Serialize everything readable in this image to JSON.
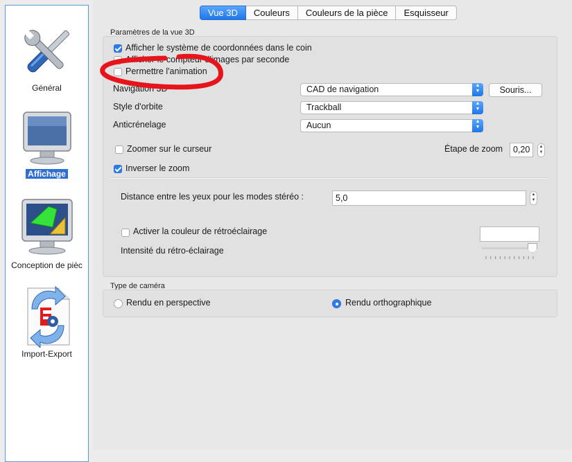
{
  "sidebar": {
    "items": [
      {
        "label": "Général",
        "icon": "tools-icon",
        "selected": false
      },
      {
        "label": "Affichage",
        "icon": "monitor-icon",
        "selected": true
      },
      {
        "label": "Conception de pièc",
        "icon": "part-design-icon",
        "selected": false
      },
      {
        "label": "Import-Export",
        "icon": "import-export-icon",
        "selected": false
      }
    ]
  },
  "tabs": [
    {
      "label": "Vue 3D",
      "active": true
    },
    {
      "label": "Couleurs",
      "active": false
    },
    {
      "label": "Couleurs de la pièce",
      "active": false
    },
    {
      "label": "Esquisseur",
      "active": false
    }
  ],
  "view3d": {
    "group_title": "Paramètres de la vue 3D",
    "show_coord_label": "Afficher le système de coordonnées dans le coin",
    "show_coord_checked": true,
    "show_fps_label": "Afficher le compteur d'images par seconde",
    "show_fps_checked": false,
    "allow_anim_label": "Permettre l'animation",
    "allow_anim_checked": false,
    "nav_label": "Navigation 3D",
    "nav_value": "CAD de navigation",
    "mouse_button": "Souris...",
    "orbit_label": "Style d'orbite",
    "orbit_value": "Trackball",
    "aa_label": "Anticrénelage",
    "aa_value": "Aucun",
    "zoom_cursor_label": "Zoomer sur le curseur",
    "zoom_cursor_checked": false,
    "zoom_step_label": "Étape de zoom",
    "zoom_step_value": "0,20",
    "invert_zoom_label": "Inverser le zoom",
    "invert_zoom_checked": true,
    "eye_dist_label": "Distance entre les yeux pour les modes stéréo :",
    "eye_dist_value": "5,0",
    "backlight_label": "Activer la couleur de rétroéclairage",
    "backlight_checked": false,
    "backlight_intensity_label": "Intensité du rétro-éclairage",
    "backlight_intensity_fraction": 1.0
  },
  "camera": {
    "group_title": "Type de caméra",
    "perspective_label": "Rendu en perspective",
    "ortho_label": "Rendu orthographique",
    "selected": "orthographic"
  },
  "colors": {
    "accent": "#2f7ce8",
    "annotation_red": "#e8141b"
  }
}
